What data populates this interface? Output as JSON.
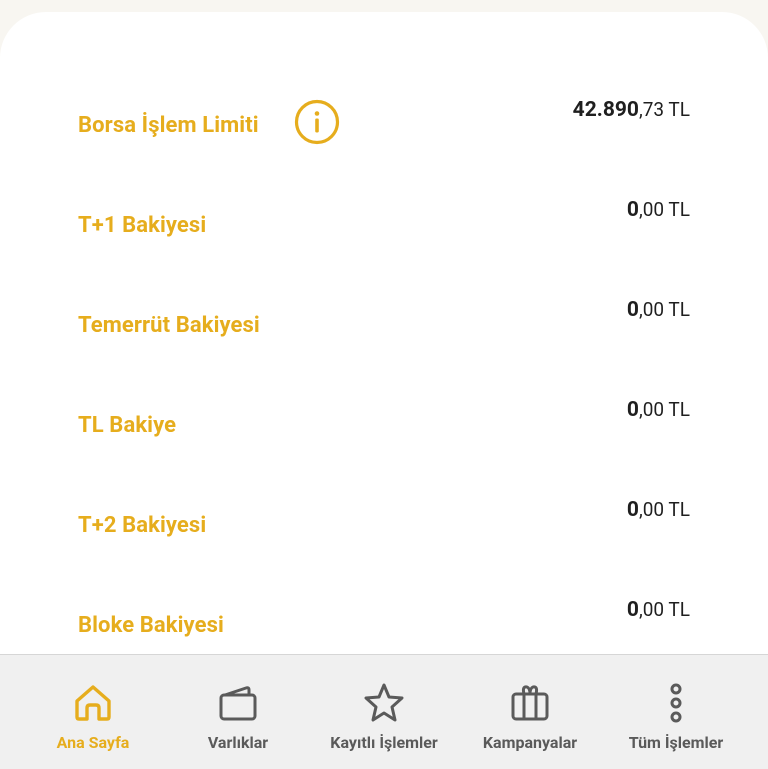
{
  "balances": [
    {
      "label": "Borsa İşlem Limiti",
      "int": "42.890",
      "dec": ",73 TL"
    },
    {
      "label": "T+1 Bakiyesi",
      "int": "0",
      "dec": ",00 TL"
    },
    {
      "label": "Temerrüt Bakiyesi",
      "int": "0",
      "dec": ",00 TL"
    },
    {
      "label": "TL Bakiye",
      "int": "0",
      "dec": ",00 TL"
    },
    {
      "label": "T+2 Bakiyesi",
      "int": "0",
      "dec": ",00 TL"
    },
    {
      "label": "Bloke Bakiyesi",
      "int": "0",
      "dec": ",00 TL"
    }
  ],
  "nav": {
    "items": [
      {
        "label": "Ana Sayfa",
        "icon": "home-icon",
        "active": true
      },
      {
        "label": "Varlıklar",
        "icon": "wallet-icon",
        "active": false
      },
      {
        "label": "Kayıtlı İşlemler",
        "icon": "star-icon",
        "active": false
      },
      {
        "label": "Kampanyalar",
        "icon": "gift-icon",
        "active": false
      },
      {
        "label": "Tüm İşlemler",
        "icon": "more-vertical-icon",
        "active": false
      }
    ]
  },
  "colors": {
    "accent": "#e6ad1d",
    "text_dark": "#1f1f1f",
    "nav_inactive": "#5a5a5a",
    "nav_background": "#f0f0f0"
  }
}
